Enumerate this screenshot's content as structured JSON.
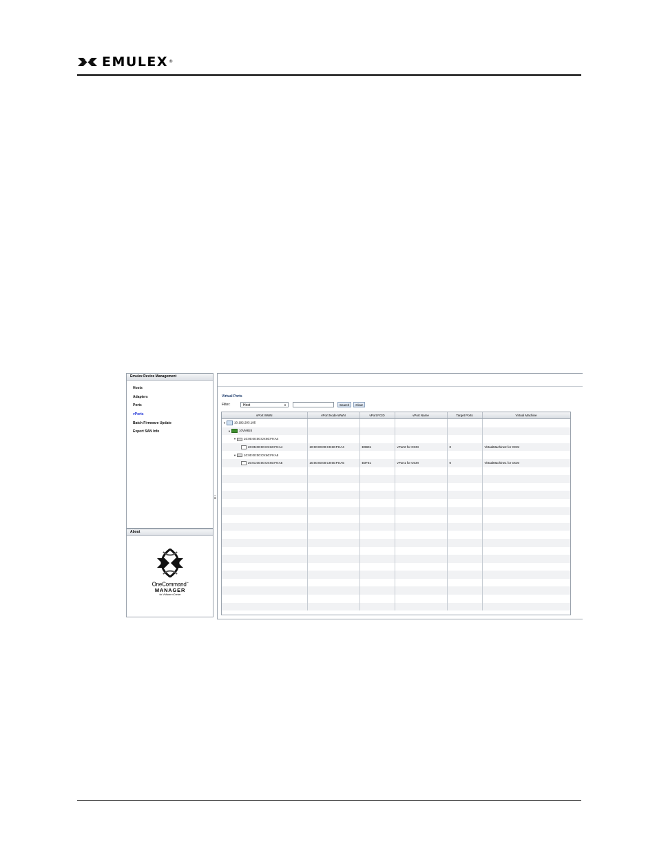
{
  "header": {
    "brand": "EMULEX",
    "trademark": "®"
  },
  "figure": {
    "nav_panel": {
      "title": "Emulex Device Management",
      "items": [
        {
          "label": "Hosts",
          "active": false
        },
        {
          "label": "Adapters",
          "active": false
        },
        {
          "label": "Ports",
          "active": false
        },
        {
          "label": "vPorts",
          "active": true
        },
        {
          "label": "Batch Firmware Update",
          "active": false
        },
        {
          "label": "Export SAN Info",
          "active": false
        }
      ]
    },
    "about_panel": {
      "title": "About",
      "product_name": "OneCommand",
      "product_tm": "™",
      "product_line2": "MANAGER",
      "product_sub": "for VMware vCenter"
    },
    "main": {
      "section_title": "Virtual Ports",
      "filter_label": "Filter:",
      "filter_value": "Host",
      "search_value": "",
      "search_button": "Search",
      "clear_button": "Clear",
      "columns": [
        "vPort WWN",
        "vPort Node WWN",
        "vPort FCID",
        "vPort Name",
        "Target Ports",
        "Virtual Machine"
      ],
      "rows": [
        {
          "level": 0,
          "icon": "host-icon",
          "wwn": "10.192.203.195",
          "node_wwn": "",
          "fcid": "",
          "name": "",
          "targets": "",
          "vm": ""
        },
        {
          "level": 1,
          "icon": "vm-host-icon",
          "wwn": "10VM824",
          "node_wwn": "",
          "fcid": "",
          "name": "",
          "targets": "",
          "vm": ""
        },
        {
          "level": 2,
          "icon": "port-icon",
          "wwn": "10:00:00:00:C9:60:F9:A4",
          "node_wwn": "",
          "fcid": "",
          "name": "",
          "targets": "",
          "vm": ""
        },
        {
          "level": 3,
          "icon": "vport-icon",
          "wwn": "20:05:00:00:C9:60:F9:A4",
          "node_wwn": "20:00:00:00:C9:60:F9:A4",
          "fcid": "E0B01",
          "name": "vPort2 for OCM",
          "targets": "0",
          "vm": "VirtualMachine2 for OCM"
        },
        {
          "level": 2,
          "icon": "port-icon",
          "wwn": "10:00:00:00:C9:60:F9:A5",
          "node_wwn": "",
          "fcid": "",
          "name": "",
          "targets": "",
          "vm": ""
        },
        {
          "level": 3,
          "icon": "vport-icon",
          "wwn": "20:01:00:00:C9:60:F9:A5",
          "node_wwn": "20:00:00:00:C9:60:F9:A5",
          "fcid": "E0F01",
          "name": "vPort1 for OCM",
          "targets": "0",
          "vm": "VirtualMachine1 for OCM"
        }
      ],
      "empty_rows": 18
    }
  }
}
